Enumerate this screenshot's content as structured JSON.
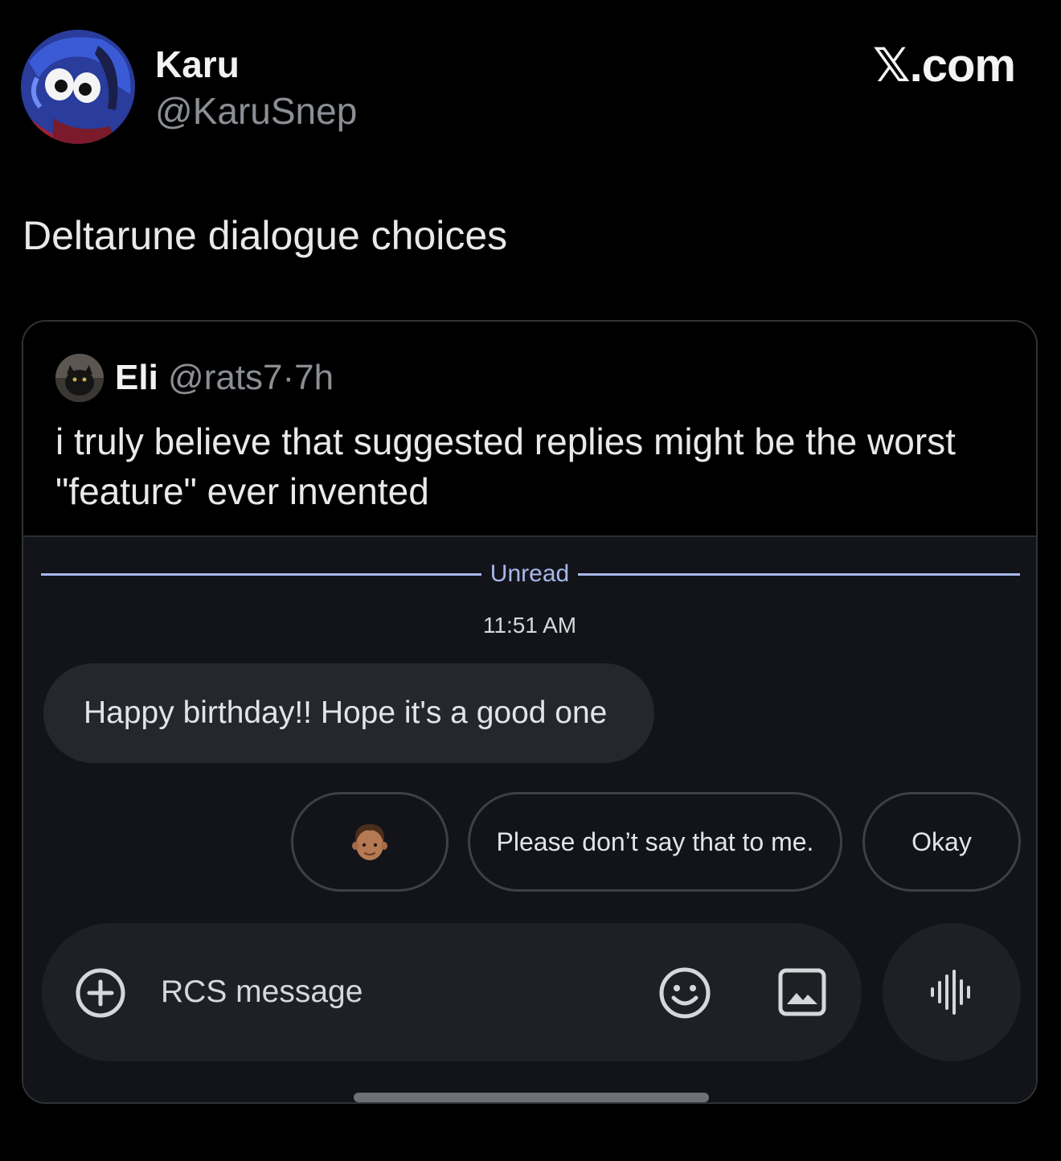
{
  "author": {
    "name": "Karu",
    "handle": "@KaruSnep"
  },
  "brand": "𝕏.com",
  "tweet": {
    "text": "Deltarune dialogue choices"
  },
  "quoted": {
    "name": "Eli",
    "handle": "@rats7",
    "separator": "·",
    "time": "7h",
    "text": "i truly believe that suggested replies might be the worst \"feature\" ever invented"
  },
  "messages_screenshot": {
    "divider_label": "Unread",
    "timestamp": "11:51 AM",
    "incoming_message": "Happy birthday!! Hope it's a good one",
    "suggested_replies": [
      {
        "icon": "man-face-emoji-icon",
        "label": ""
      },
      {
        "label": "Please don’t say that to me."
      },
      {
        "label": "Okay"
      }
    ],
    "composer_placeholder": "RCS message",
    "icons": [
      "plus-circle-icon",
      "emoji-icon",
      "image-icon",
      "voice-waveform-icon"
    ]
  },
  "colors": {
    "background": "#000000",
    "accent": "#a9b8ea",
    "bubble": "#26272d",
    "embed_background": "#131419"
  }
}
